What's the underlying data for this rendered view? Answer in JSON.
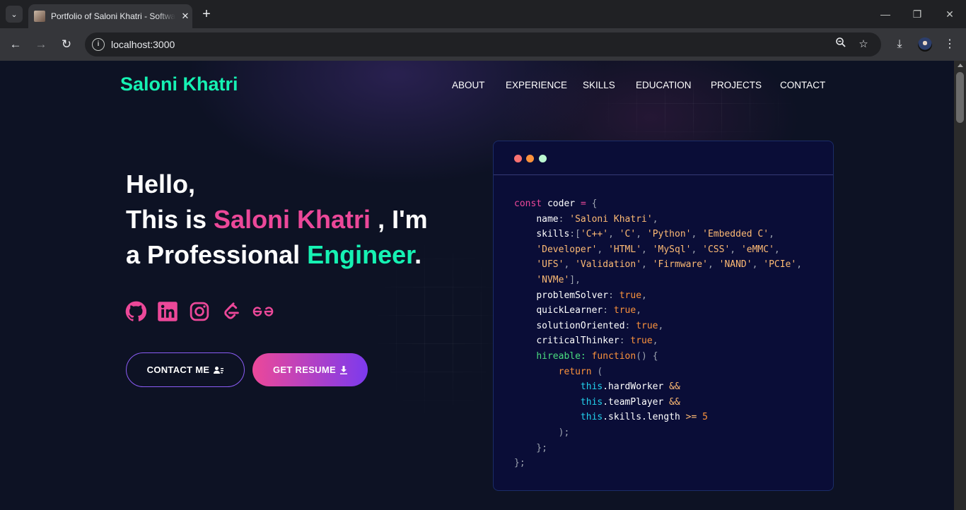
{
  "browser": {
    "tab_title": "Portfolio of Saloni Khatri - Software Developer",
    "url": "localhost:3000"
  },
  "site": {
    "brand": "Saloni Khatri",
    "nav": [
      "ABOUT",
      "EXPERIENCE",
      "SKILLS",
      "EDUCATION",
      "PROJECTS",
      "CONTACT"
    ]
  },
  "hero": {
    "line1": "Hello,",
    "line2_prefix": "This is ",
    "name": "Saloni Khatri",
    "line2_suffix": " , I'm",
    "line3_prefix": "a Professional ",
    "role": "Engineer",
    "line3_suffix": ".",
    "contact_label": "CONTACT ME",
    "resume_label": "GET RESUME",
    "social_icons": [
      "github-icon",
      "linkedin-icon",
      "instagram-icon",
      "leetcode-icon",
      "geeksforgeeks-icon"
    ]
  },
  "code": {
    "l1_kw": "const",
    "l1_var": " coder ",
    "l1_eq": "=",
    "l1_brace": " {",
    "name_key": "name",
    "name_val": "'Saloni Khatri'",
    "skills_key": "skills",
    "skills": [
      "'C++'",
      "'C'",
      "'Python'",
      "'Embedded C'",
      "'Developer'",
      "'HTML'",
      "'MySql'",
      "'CSS'",
      "'eMMC'",
      "'UFS'",
      "'Validation'",
      "'Firmware'",
      "'NAND'",
      "'PCIe'",
      "'NVMe'"
    ],
    "problem_key": "problemSolver",
    "quick_key": "quickLearner",
    "solution_key": "solutionOriented",
    "critical_key": "criticalThinker",
    "true_val": "true",
    "hireable_key": "hireable:",
    "function_kw": "function",
    "return_kw": "return",
    "this_kw": "this",
    "hard": ".hardWorker",
    "team": ".teamPlayer",
    "skills_len": ".skills.length",
    "and_op": "&&",
    "gte_op": ">=",
    "five": "5"
  },
  "colors": {
    "accent_pink": "#ec4899",
    "accent_green": "#16f2b3",
    "accent_violet": "#7c3aed",
    "page_bg": "#0d1224",
    "card_bg": "#0a0d37",
    "dot_red": "#f87171",
    "dot_orange": "#fb923c",
    "dot_green": "#bbf7d0"
  }
}
